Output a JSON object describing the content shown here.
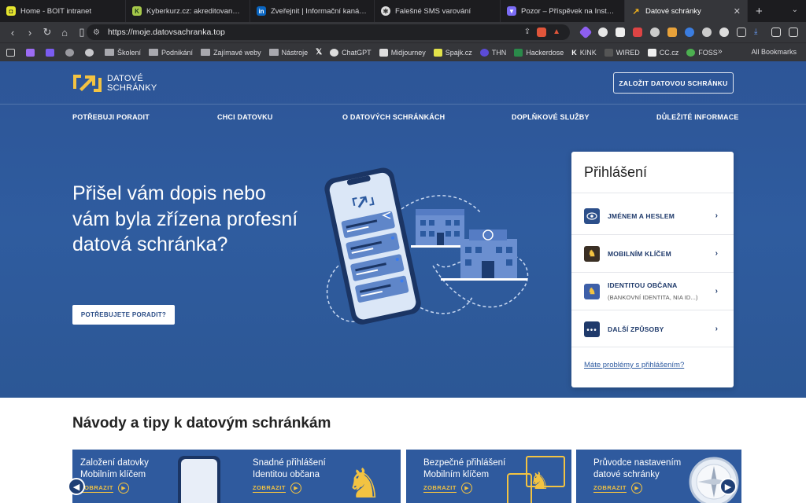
{
  "browser": {
    "tabs": [
      {
        "title": "Home - BOIT intranet",
        "icon": "boit-icon",
        "color": "#e5e52e"
      },
      {
        "title": "Kyberkurz.cz: akreditovaný on-li",
        "icon": "kyberkurz-icon",
        "color": "#a6c84a"
      },
      {
        "title": "Zveřejnit | Informační kanál | Link",
        "icon": "linkedin-icon",
        "color": "#0a66c2"
      },
      {
        "title": "Falešné SMS varování",
        "icon": "chatgpt-icon",
        "color": "#dddddd"
      },
      {
        "title": "Pozor – Příspěvek na Instagramu",
        "icon": "shield-icon",
        "color": "#7b6cf6"
      },
      {
        "title": "Datové schránky",
        "icon": "datove-schranky-icon",
        "color": "#f2b21b"
      }
    ],
    "url": "https://moje.datovsachranka.top",
    "bookmarks": [
      {
        "label": "",
        "icon": "gmail-icon"
      },
      {
        "label": "",
        "icon": "purple-icon"
      },
      {
        "label": "",
        "icon": "alien-icon"
      },
      {
        "label": "",
        "icon": "ghost-icon"
      },
      {
        "label": "Školení",
        "icon": "folder-icon"
      },
      {
        "label": "Podnikání",
        "icon": "folder-icon"
      },
      {
        "label": "Zajímavé weby",
        "icon": "folder-icon"
      },
      {
        "label": "Nástroje",
        "icon": "folder-icon"
      },
      {
        "label": "",
        "icon": "x-icon"
      },
      {
        "label": "ChatGPT",
        "icon": "chatgpt-icon"
      },
      {
        "label": "Midjourney",
        "icon": "midjourney-icon"
      },
      {
        "label": "Spajk.cz",
        "icon": "spajk-icon"
      },
      {
        "label": "THN",
        "icon": "thn-icon"
      },
      {
        "label": "Hackerdose",
        "icon": "hackerdose-icon"
      },
      {
        "label": "KINK",
        "icon": "kink-icon"
      },
      {
        "label": "WIRED",
        "icon": "wired-icon"
      },
      {
        "label": "CC.cz",
        "icon": "cc-icon"
      },
      {
        "label": "FOSS",
        "icon": "foss-icon"
      }
    ],
    "more_bookmarks": "»",
    "all_bookmarks": "All Bookmarks"
  },
  "site": {
    "logo_line1": "DATOVÉ",
    "logo_line2": "SCHRÁNKY",
    "create_button": "ZALOŽIT DATOVOU SCHRÁNKU",
    "nav": [
      "POTŘEBUJI PORADIT",
      "CHCI DATOVKU",
      "O DATOVÝCH SCHRÁNKÁCH",
      "DOPLŇKOVÉ SLUŽBY",
      "DŮLEŽITÉ INFORMACE"
    ],
    "hero_title": "Přišel vám dopis nebo vám byla zřízena profesní datová schránka?",
    "hero_button": "POTŘEBUJETE PORADIT?",
    "login": {
      "title": "Přihlášení",
      "options": [
        {
          "label": "JMÉNEM A HESLEM",
          "sub": "",
          "icon": "eye-icon"
        },
        {
          "label": "MOBILNÍM KLÍČEM",
          "sub": "",
          "icon": "lion-icon"
        },
        {
          "label": "IDENTITOU OBČANA",
          "sub": "(BANKOVNÍ IDENTITA, NIA ID...)",
          "icon": "citizen-identity-icon"
        },
        {
          "label": "DALŠÍ ZPŮSOBY",
          "sub": "",
          "icon": "more-dots-icon"
        }
      ],
      "help_link": "Máte problémy s přihlášením?"
    },
    "tips_title": "Návody a tipy k datovým schránkám",
    "cards": [
      {
        "title1": "Založení datovky",
        "title2": "Mobilním klíčem",
        "button": "ZOBRAZIT"
      },
      {
        "title1": "Snadné přihlášení",
        "title2": "Identitou občana",
        "button": "ZOBRAZIT"
      },
      {
        "title1": "Bezpečné přihlášení",
        "title2": "Mobilním klíčem",
        "button": "ZOBRAZIT"
      },
      {
        "title1": "Průvodce nastavením",
        "title2": "datové schránky",
        "button": "ZOBRAZIT"
      }
    ],
    "colors": {
      "primary": "#2d5597",
      "accent": "#f3c342",
      "card": "#2f5a9e"
    }
  }
}
